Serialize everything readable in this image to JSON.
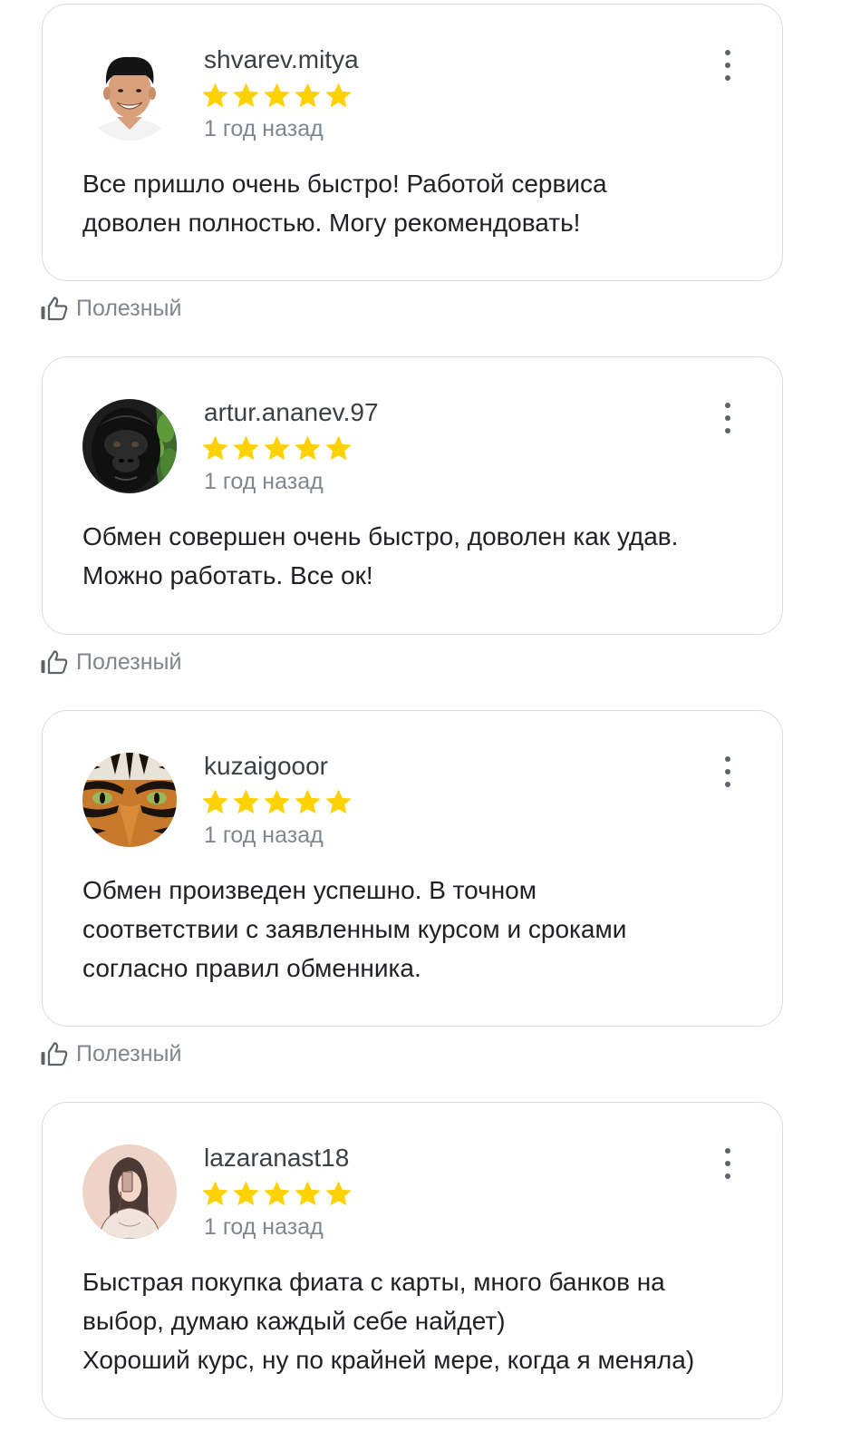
{
  "helpful_label": "Полезный",
  "star_color": "#fdd200",
  "reviews": [
    {
      "username": "shvarev.mitya",
      "rating": 5,
      "time_ago": "1 год назад",
      "text": "Все пришло очень быстро! Работой сервиса\nдоволен полностью. Могу рекомендовать!",
      "avatar": "man-photo-avatar"
    },
    {
      "username": "artur.ananev.97",
      "rating": 5,
      "time_ago": "1 год назад",
      "text": "Обмен совершен очень быстро, доволен как удав.\nМожно работать. Все ок!",
      "avatar": "gorilla-photo-avatar"
    },
    {
      "username": "kuzaigooor",
      "rating": 5,
      "time_ago": "1 год назад",
      "text": "Обмен произведен успешно. В точном\nсоответствии с заявленным курсом и сроками\nсогласно правил обменника.",
      "avatar": "tiger-photo-avatar"
    },
    {
      "username": "lazaranast18",
      "rating": 5,
      "time_ago": "1 год назад",
      "text": "Быстрая покупка фиата с карты, много банков на\nвыбор, думаю каждый себе найдет)\nХороший курс, ну по крайней мере, когда я меняла)",
      "avatar": "girl-drawing-avatar"
    }
  ]
}
